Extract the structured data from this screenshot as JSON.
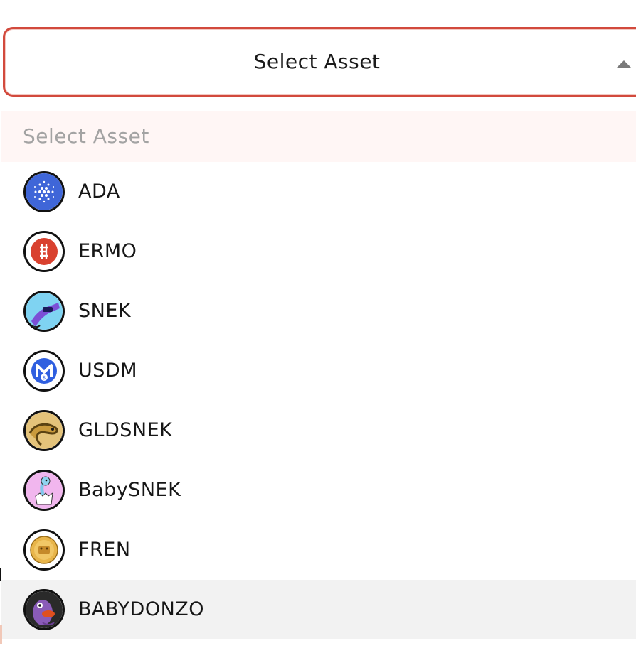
{
  "select": {
    "value": "Select Asset",
    "caret_icon": "caret-up-icon",
    "accent_color": "#d24a3d"
  },
  "menu": {
    "placeholder": "Select Asset",
    "options": [
      {
        "label": "ADA",
        "icon": "ada-token-icon"
      },
      {
        "label": "ERMO",
        "icon": "ermo-token-icon"
      },
      {
        "label": "SNEK",
        "icon": "snek-token-icon"
      },
      {
        "label": "USDM",
        "icon": "usdm-token-icon"
      },
      {
        "label": "GLDSNEK",
        "icon": "gldsnek-token-icon"
      },
      {
        "label": "BabySNEK",
        "icon": "babysnek-token-icon"
      },
      {
        "label": "FREN",
        "icon": "fren-token-icon"
      },
      {
        "label": "BABYDONZO",
        "icon": "babydonzo-token-icon",
        "highlighted": true
      }
    ]
  }
}
